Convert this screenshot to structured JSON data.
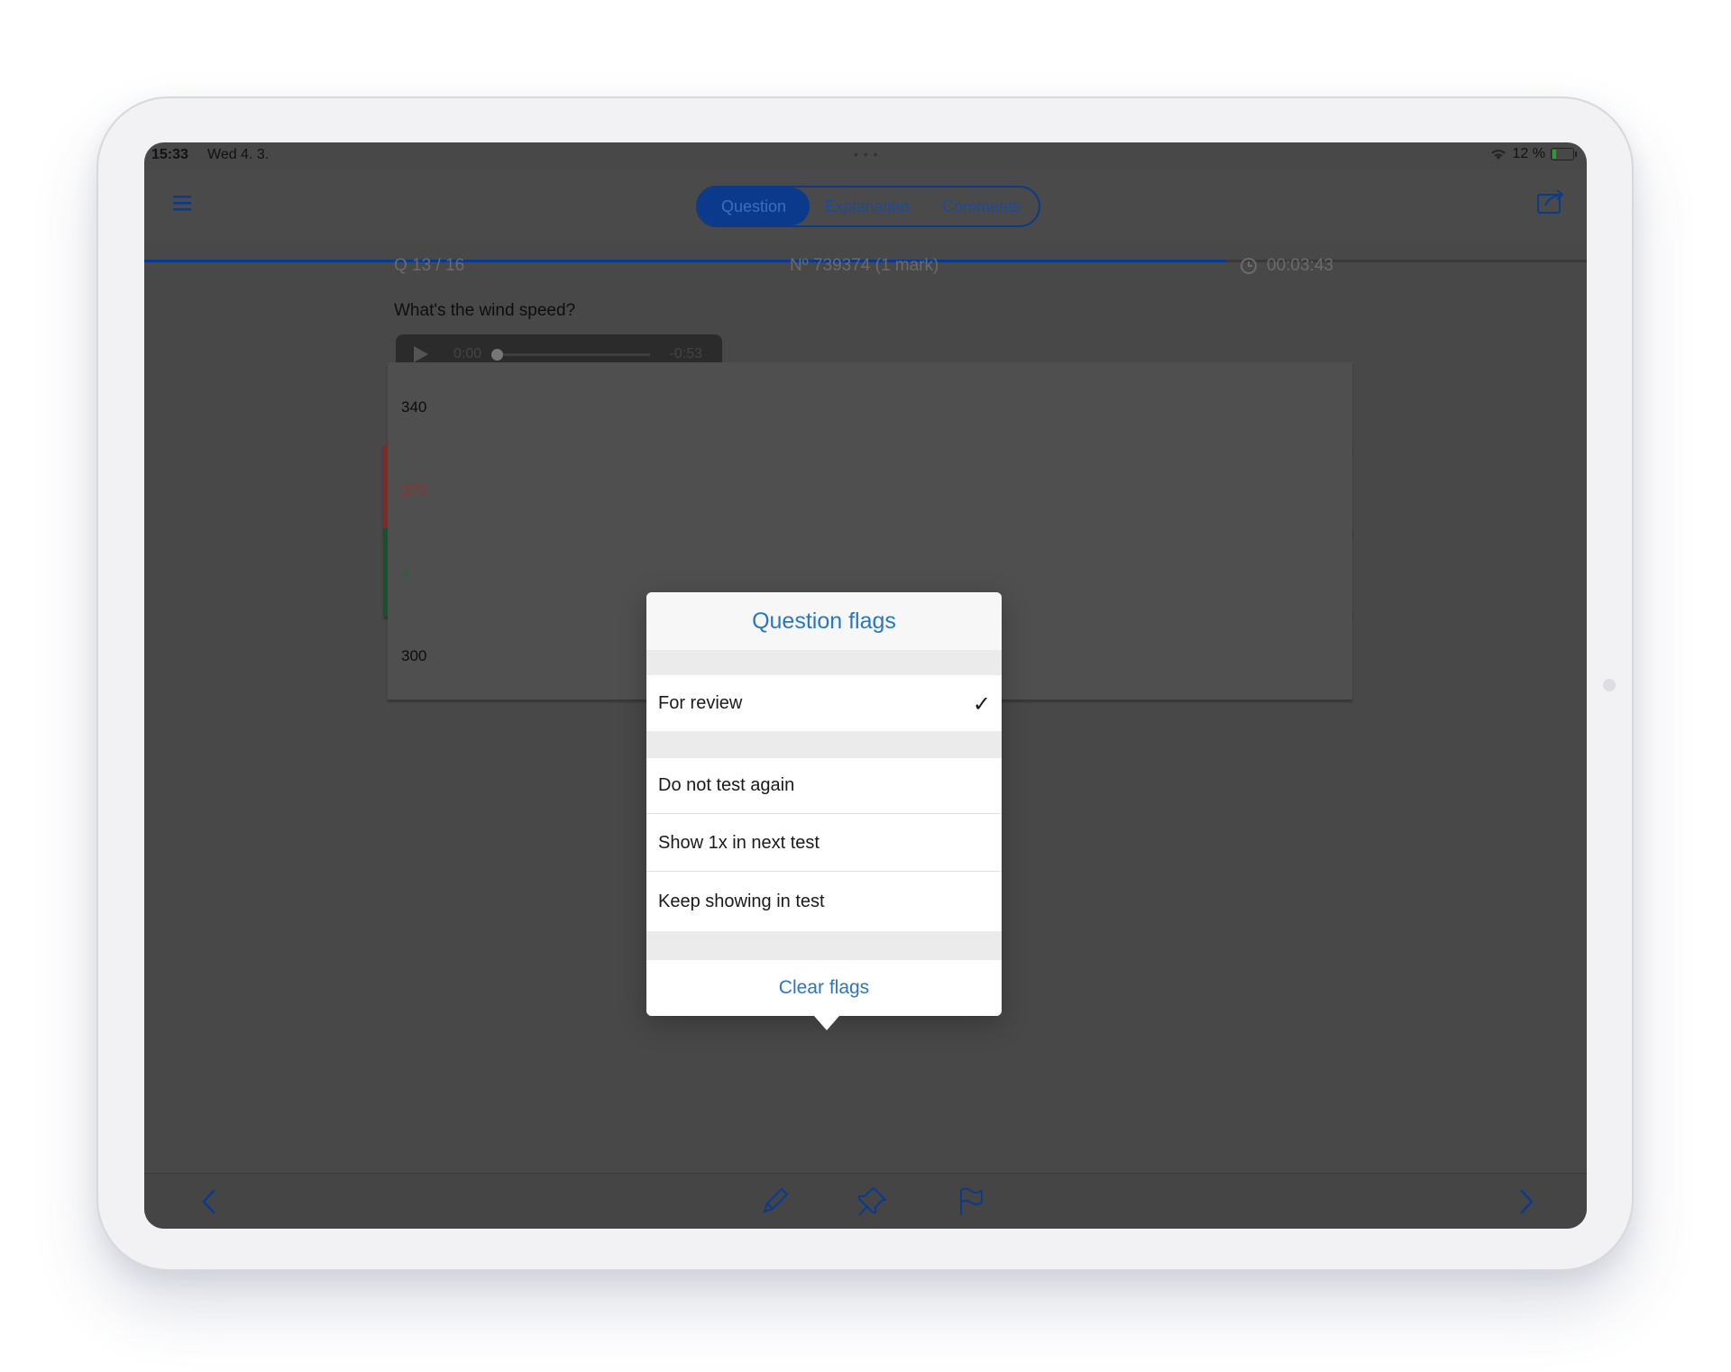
{
  "status_bar": {
    "time": "15:33",
    "date": "Wed 4. 3.",
    "dots": "• • •",
    "battery": "12 %"
  },
  "nav": {
    "tabs": [
      {
        "label": "Question",
        "active": true
      },
      {
        "label": "Explanation",
        "active": false
      },
      {
        "label": "Comments",
        "active": false
      }
    ],
    "progress_fraction": 0.75
  },
  "question": {
    "number": "Q  13 / 16",
    "id": "Nº 739374 (1 mark)",
    "timer": "00:03:43",
    "text": "What's the wind speed?",
    "audio": {
      "current": "0:00",
      "remaining": "-0:53",
      "progress_fraction": 0.0
    }
  },
  "answers": [
    {
      "label": "340",
      "state": "neutral"
    },
    {
      "label": "270",
      "state": "wrong"
    },
    {
      "label": "4",
      "state": "correct"
    },
    {
      "label": "300",
      "state": "neutral"
    }
  ],
  "flags_popover": {
    "title": "Question flags",
    "items": {
      "for_review": "For review",
      "do_not_test": "Do not test again",
      "show_once": "Show 1x in next test",
      "keep_showing": "Keep showing in test"
    },
    "checked": "for_review",
    "check_mark": "✓",
    "clear_label": "Clear flags"
  },
  "toolbar": {
    "icons": [
      "chevron-left-icon",
      "pencil-icon",
      "pin-icon",
      "flag-icon",
      "chevron-right-icon"
    ]
  },
  "colors": {
    "accent_blue": "#2777c6",
    "nav_blue": "#0b3a8c",
    "wrong": "#8c2424",
    "correct": "#17532a"
  }
}
